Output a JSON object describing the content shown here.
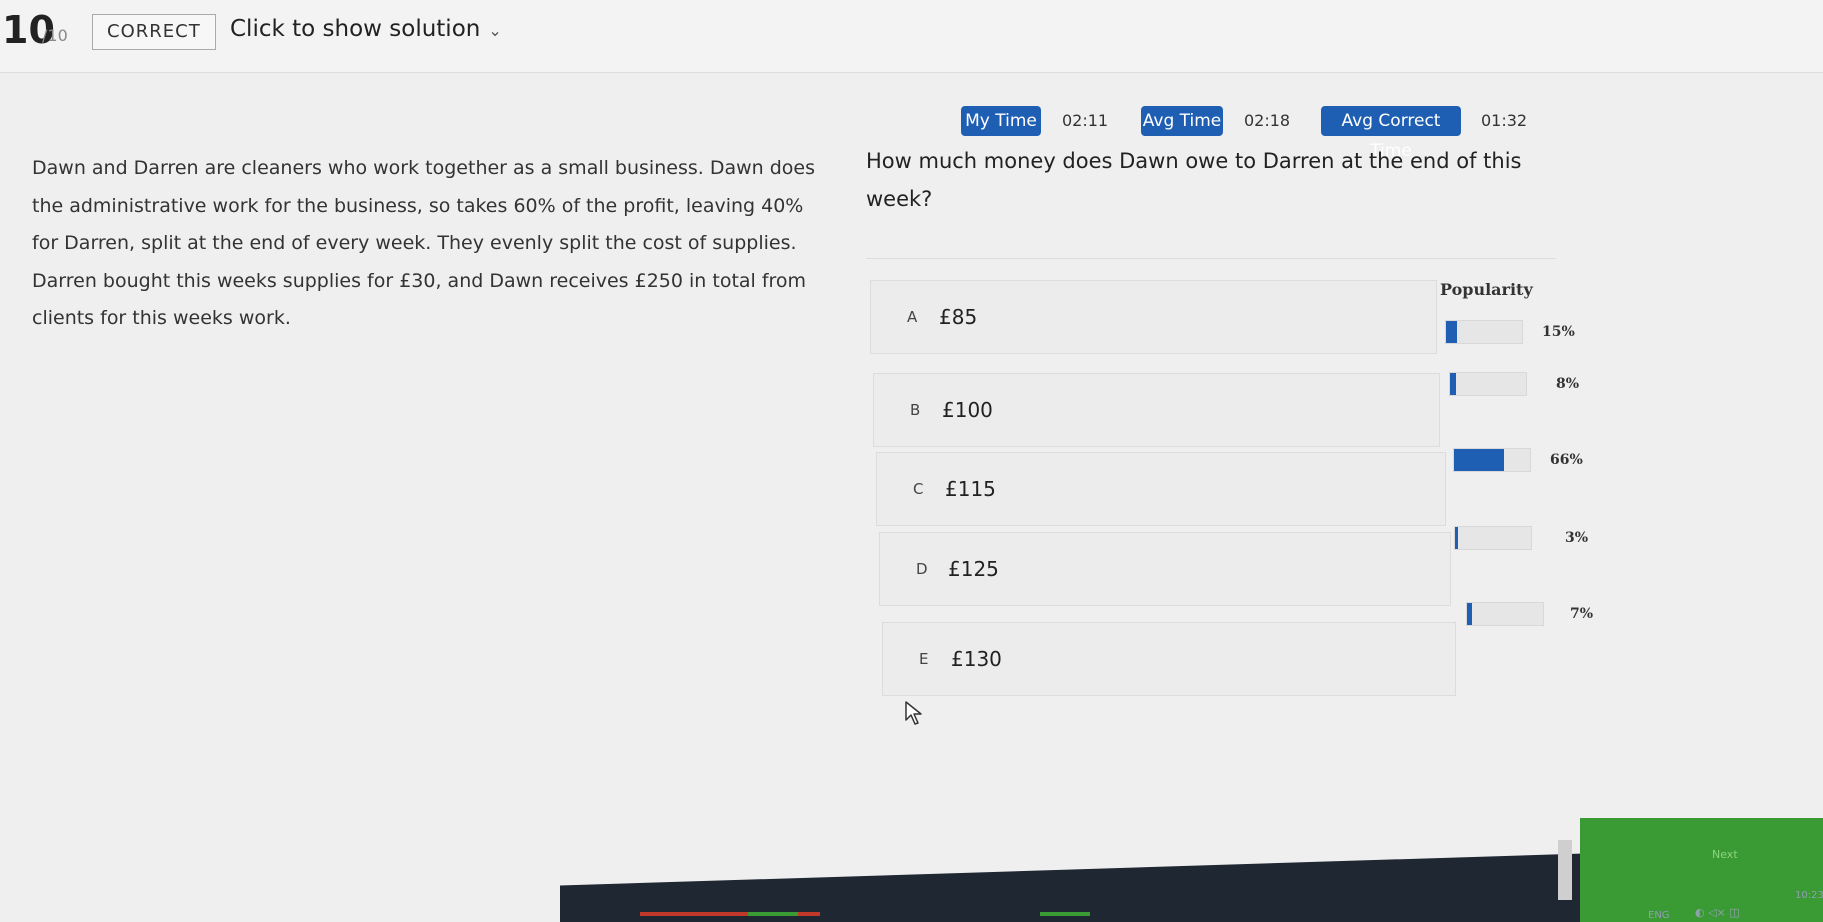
{
  "header": {
    "score": "10",
    "score_total": "/10",
    "status_badge": "CORRECT",
    "solution_link": "Click to show solution",
    "solution_chevron": "⌄"
  },
  "timing": {
    "my_time_label": "My Time",
    "my_time_value": "02:11",
    "avg_time_label": "Avg Time",
    "avg_time_value": "02:18",
    "avg_correct_label": "Avg Correct Time",
    "avg_correct_value": "01:32"
  },
  "passage": {
    "text": "Dawn and Darren are cleaners who work together as a small business. Dawn does the administrative work for the business, so takes 60% of the profit, leaving 40% for Darren, split at the end of every week. They evenly split the cost of supplies. Darren bought this weeks supplies for £30, and Dawn receives £250 in total from clients for this weeks work."
  },
  "question": {
    "text": "How much money does Dawn owe to Darren at the end of this week?"
  },
  "popularity_label": "Popularity",
  "options": [
    {
      "letter": "A",
      "text": "£85",
      "popularity": "15%",
      "fraction": 0.15
    },
    {
      "letter": "B",
      "text": "£100",
      "popularity": "8%",
      "fraction": 0.08
    },
    {
      "letter": "C",
      "text": "£115",
      "popularity": "66%",
      "fraction": 0.66
    },
    {
      "letter": "D",
      "text": "£125",
      "popularity": "3%",
      "fraction": 0.03
    },
    {
      "letter": "E",
      "text": "£130",
      "popularity": "7%",
      "fraction": 0.07
    }
  ],
  "footer": {
    "next_label": "Next",
    "lang": "ENG",
    "clock": "10:23"
  },
  "colors": {
    "accent_blue": "#1f5fb3",
    "next_green": "#3a9a34",
    "taskbar": "#1f2732"
  }
}
